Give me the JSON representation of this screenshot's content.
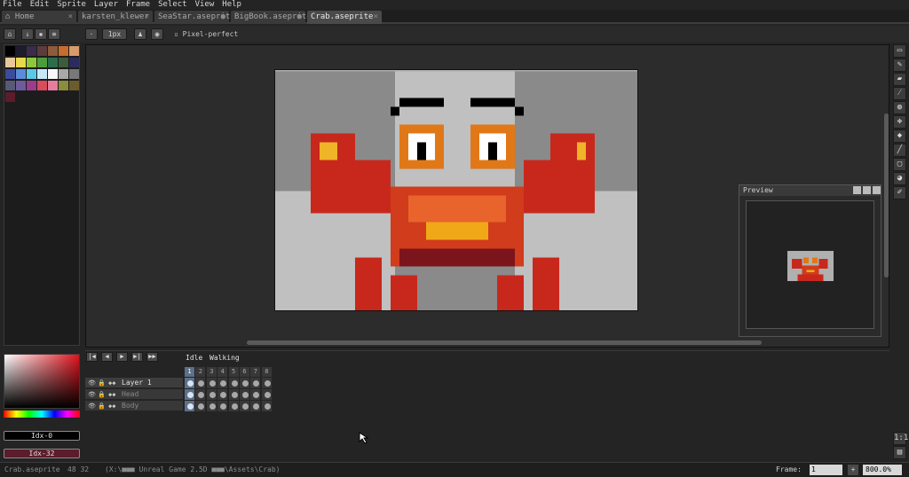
{
  "menu": [
    "File",
    "Edit",
    "Sprite",
    "Layer",
    "Frame",
    "Select",
    "View",
    "Help"
  ],
  "tabs": [
    {
      "label": "Home",
      "close": "×"
    },
    {
      "label": "karsten_klewer",
      "close": "×"
    },
    {
      "label": "SeaStar.aseprit",
      "close": "●"
    },
    {
      "label": "BigBook.aseprite",
      "close": "●"
    },
    {
      "label": "Crab.aseprite",
      "close": "×"
    }
  ],
  "toolbar": {
    "brush_size": "1px",
    "pixel_perfect_label": "Pixel-perfect"
  },
  "palette_colors": [
    "#000000",
    "#1c1c2c",
    "#3c2c4c",
    "#5c3c3c",
    "#8c5c3c",
    "#c86c2c",
    "#d89c6c",
    "#e8c89c",
    "#e8d84c",
    "#8cc83c",
    "#4c9c3c",
    "#2c6c4c",
    "#3c5c3c",
    "#2c2c5c",
    "#3c4c9c",
    "#5c8cd8",
    "#5cc8e8",
    "#c8e8f8",
    "#f8f8f8",
    "#a8a8a8",
    "#787878",
    "#585878",
    "#6c5c9c",
    "#9c3c8c",
    "#d84c5c",
    "#e87c9c",
    "#8c8c3c",
    "#6c5c2c",
    "#5c1c2c"
  ],
  "color_index_fg": "Idx-0",
  "color_index_bg": "Idx-32",
  "colors": {
    "bg_index": "#5c1c2c"
  },
  "preview": {
    "title": "Preview"
  },
  "timeline": {
    "tags": [
      {
        "label": "Idle"
      },
      {
        "label": "Walking"
      }
    ],
    "frames": [
      "1",
      "2",
      "3",
      "4",
      "5",
      "6",
      "7",
      "8"
    ],
    "layers": [
      {
        "name": "Layer 1",
        "dim": false
      },
      {
        "name": "Head",
        "dim": true
      },
      {
        "name": "Body",
        "dim": true
      }
    ]
  },
  "status": {
    "filename": "Crab.aseprite",
    "size": "48 32",
    "path": "(X:\\■■■ Unreal Game 2.5D ■■■\\Assets\\Crab)",
    "frame_label": "Frame:",
    "frame_value": "1",
    "zoom": "800.0%",
    "add": "+"
  }
}
